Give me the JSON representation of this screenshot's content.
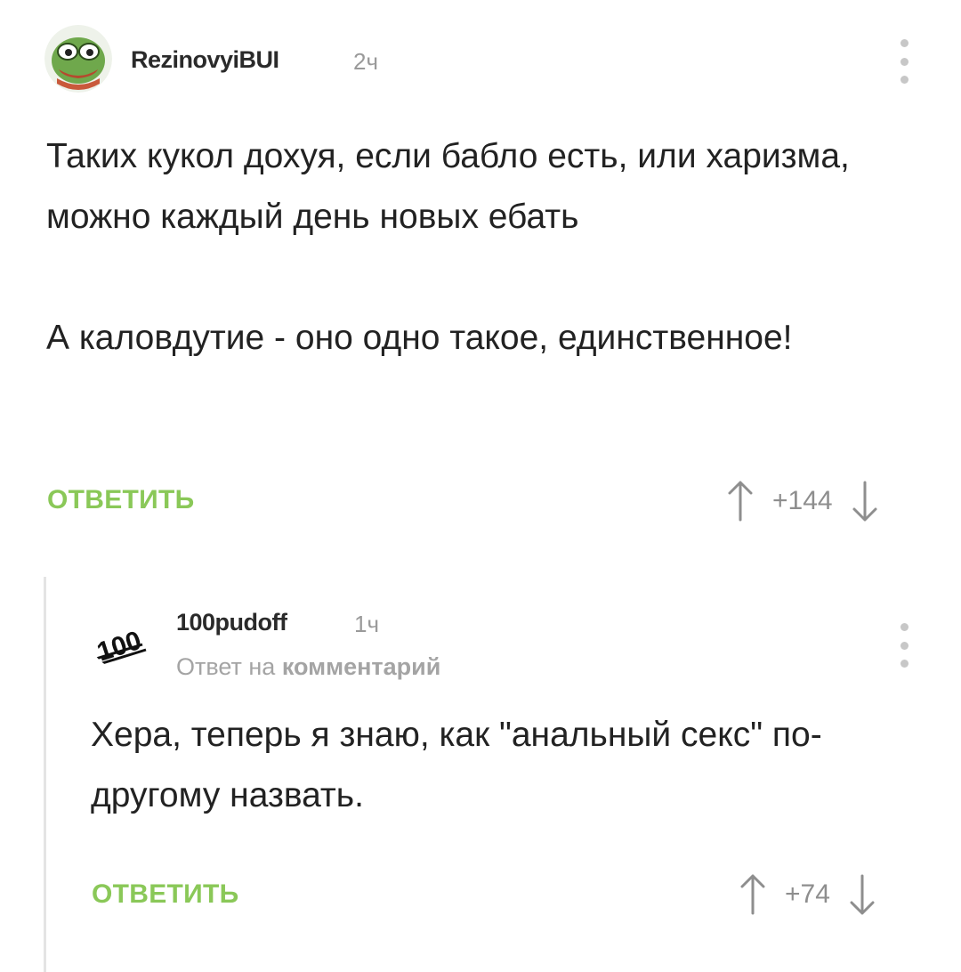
{
  "comments": [
    {
      "username": "RezinovyiBUI",
      "time": "2ч",
      "avatar_icon": "pepe-frog-avatar",
      "paragraphs": [
        "Таких кукол дохуя, если бабло есть, или харизма, можно каждый день новых ебать",
        "А каловдутие - оно одно такое, единственное!"
      ],
      "reply_label": "ОТВЕТИТЬ",
      "score": "+144"
    },
    {
      "username": "100pudoff",
      "time": "1ч",
      "avatar_icon": "hundred-emoji-avatar",
      "reply_to_prefix": "Ответ на",
      "reply_to_link": "комментарий",
      "paragraphs": [
        "Хера, теперь я знаю, как \"анальный секс\" по-другому назвать."
      ],
      "reply_label": "ОТВЕТИТЬ",
      "score": "+74"
    }
  ],
  "colors": {
    "accent_green": "#8ac858",
    "muted_text": "#9a9a9a",
    "thread_line": "#e4e4e4"
  }
}
